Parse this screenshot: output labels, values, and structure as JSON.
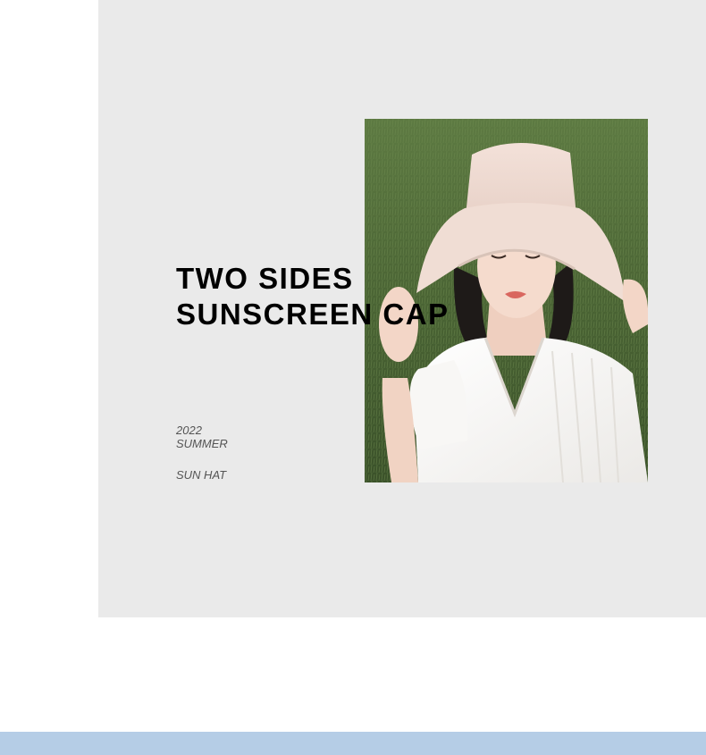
{
  "banner": {
    "headline_line1": "TWO SIDES",
    "headline_line2": "SUNSCREEN CAP",
    "year": "2022",
    "season": "SUMMER",
    "product": "SUN HAT"
  },
  "photo": {
    "subject": "woman wearing reversible bucket sun hat on grass"
  },
  "colors": {
    "panel_background": "#eaeaea",
    "page_background": "#ffffff",
    "headline": "#000000",
    "meta_text": "#555555",
    "bottom_strip": "#b5cde6"
  }
}
